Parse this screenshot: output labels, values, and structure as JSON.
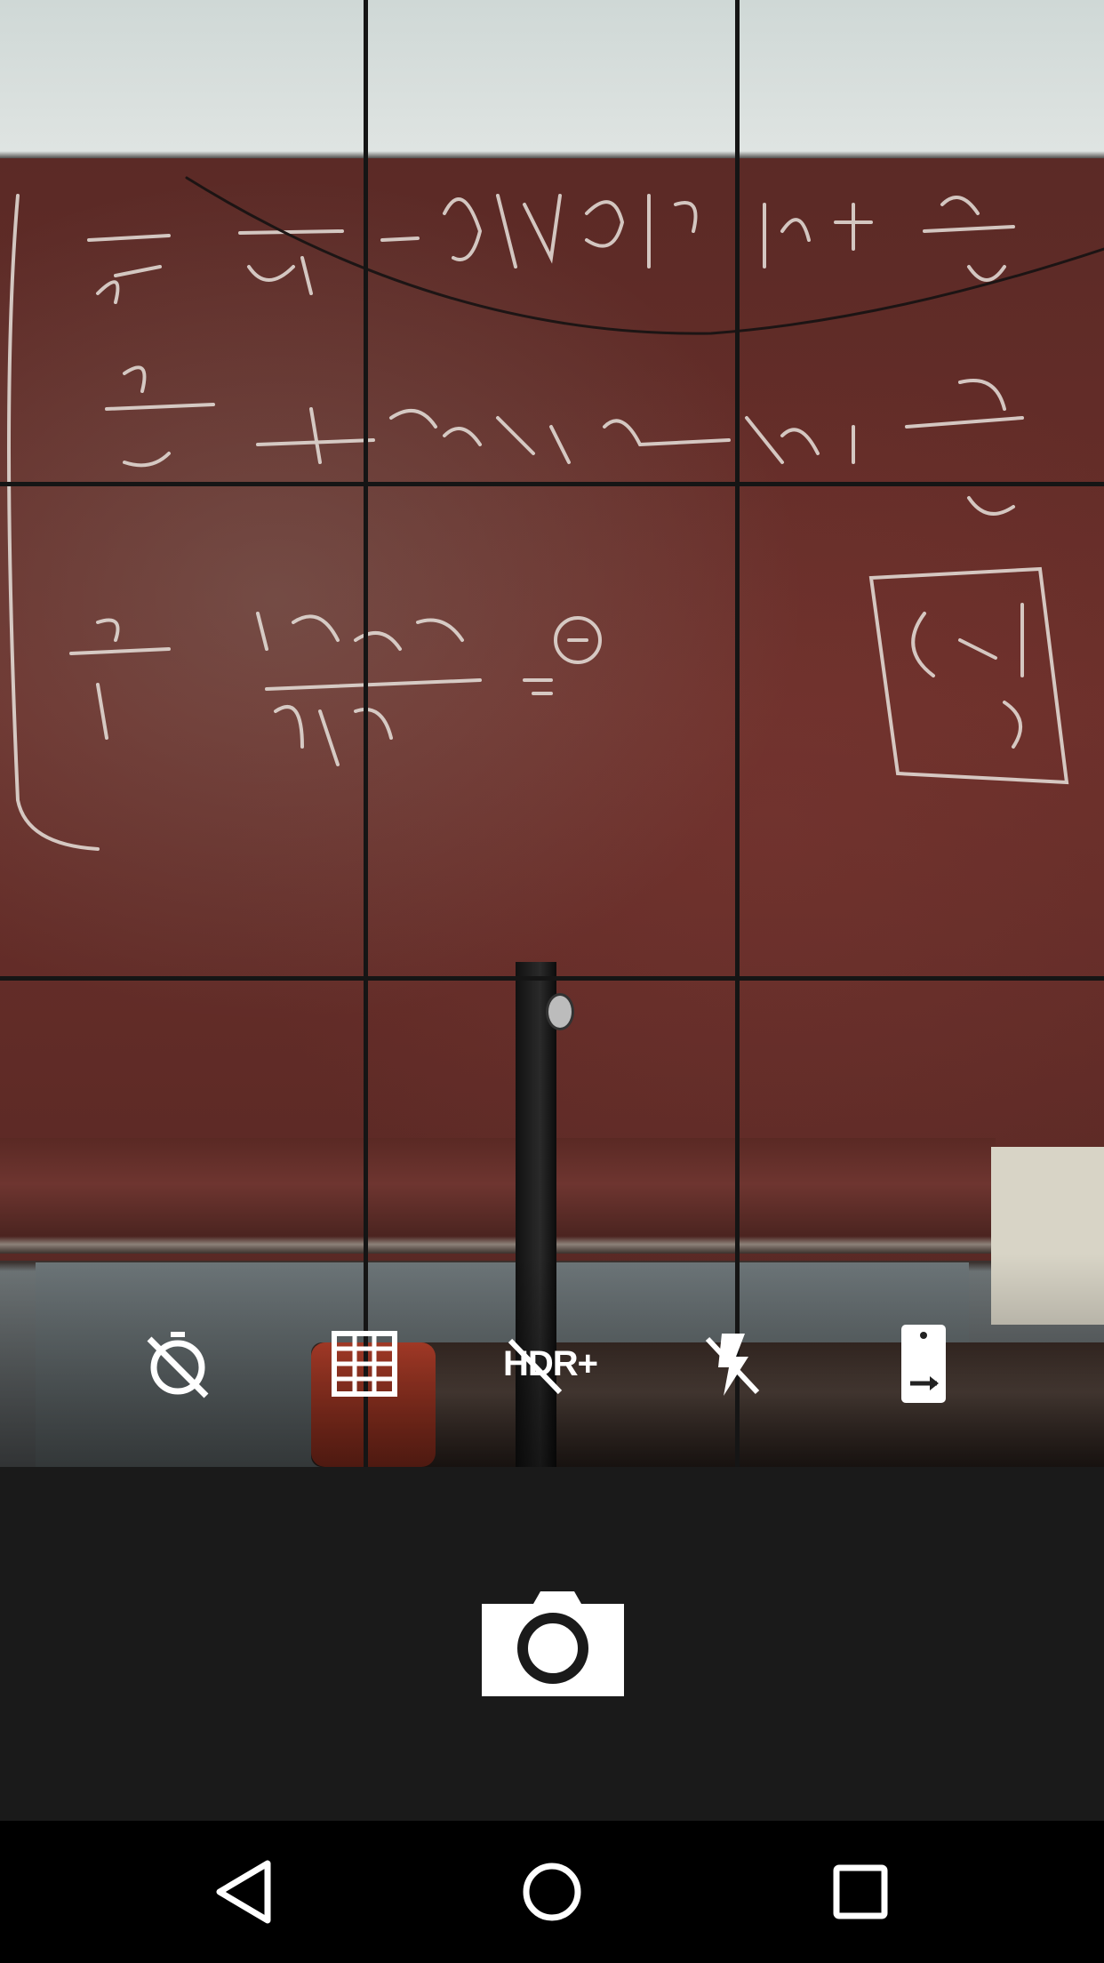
{
  "camera": {
    "controls": {
      "timer": {
        "icon": "timer-off-icon",
        "state": "off"
      },
      "grid": {
        "icon": "grid-icon",
        "state": "on"
      },
      "hdr": {
        "icon": "hdr-plus-off-icon",
        "label": "HDR+",
        "state": "off"
      },
      "flash": {
        "icon": "flash-off-icon",
        "state": "off"
      },
      "switch_camera": {
        "icon": "switch-camera-icon"
      }
    },
    "shutter": {
      "icon": "camera-shutter-icon"
    },
    "grid_overlay": "3x3"
  },
  "navigation": {
    "back": {
      "icon": "back-triangle-icon"
    },
    "home": {
      "icon": "home-circle-icon"
    },
    "recents": {
      "icon": "recents-square-icon"
    }
  },
  "colors": {
    "bottom_bar": "#1a1a1a",
    "nav_bar": "#000000",
    "icon": "#ffffff"
  }
}
